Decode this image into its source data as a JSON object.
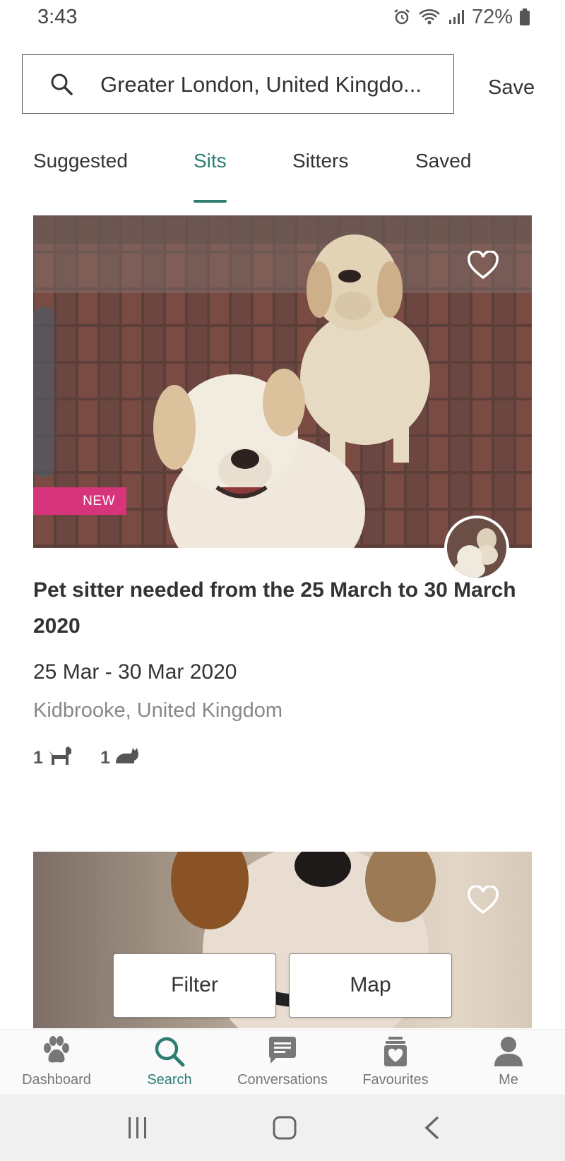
{
  "status_bar": {
    "time": "3:43",
    "battery": "72%",
    "icons": [
      "alarm-icon",
      "wifi-icon",
      "signal-icon",
      "battery-icon"
    ]
  },
  "search": {
    "value": "Greater London, United Kingdo...",
    "save_label": "Save"
  },
  "tabs": [
    {
      "label": "Suggested",
      "active": false
    },
    {
      "label": "Sits",
      "active": true
    },
    {
      "label": "Sitters",
      "active": false
    },
    {
      "label": "Saved",
      "active": false
    }
  ],
  "listing": {
    "badge": "NEW",
    "title": "Pet sitter needed from the 25 March to 30 March 2020",
    "dates": "25 Mar - 30 Mar 2020",
    "location": "Kidbrooke, United Kingdom",
    "pets": [
      {
        "count": "1",
        "icon": "dog-icon"
      },
      {
        "count": "1",
        "icon": "cat-icon"
      }
    ]
  },
  "floating_buttons": {
    "filter_label": "Filter",
    "map_label": "Map"
  },
  "bottom_nav": [
    {
      "label": "Dashboard",
      "icon": "paw-icon",
      "active": false
    },
    {
      "label": "Search",
      "icon": "search-icon",
      "active": true
    },
    {
      "label": "Conversations",
      "icon": "chat-icon",
      "active": false
    },
    {
      "label": "Favourites",
      "icon": "favourites-icon",
      "active": false
    },
    {
      "label": "Me",
      "icon": "person-icon",
      "active": false
    }
  ],
  "colors": {
    "accent": "#2d7d73",
    "badge": "#d8347c",
    "text": "#333333",
    "muted": "#888888"
  }
}
